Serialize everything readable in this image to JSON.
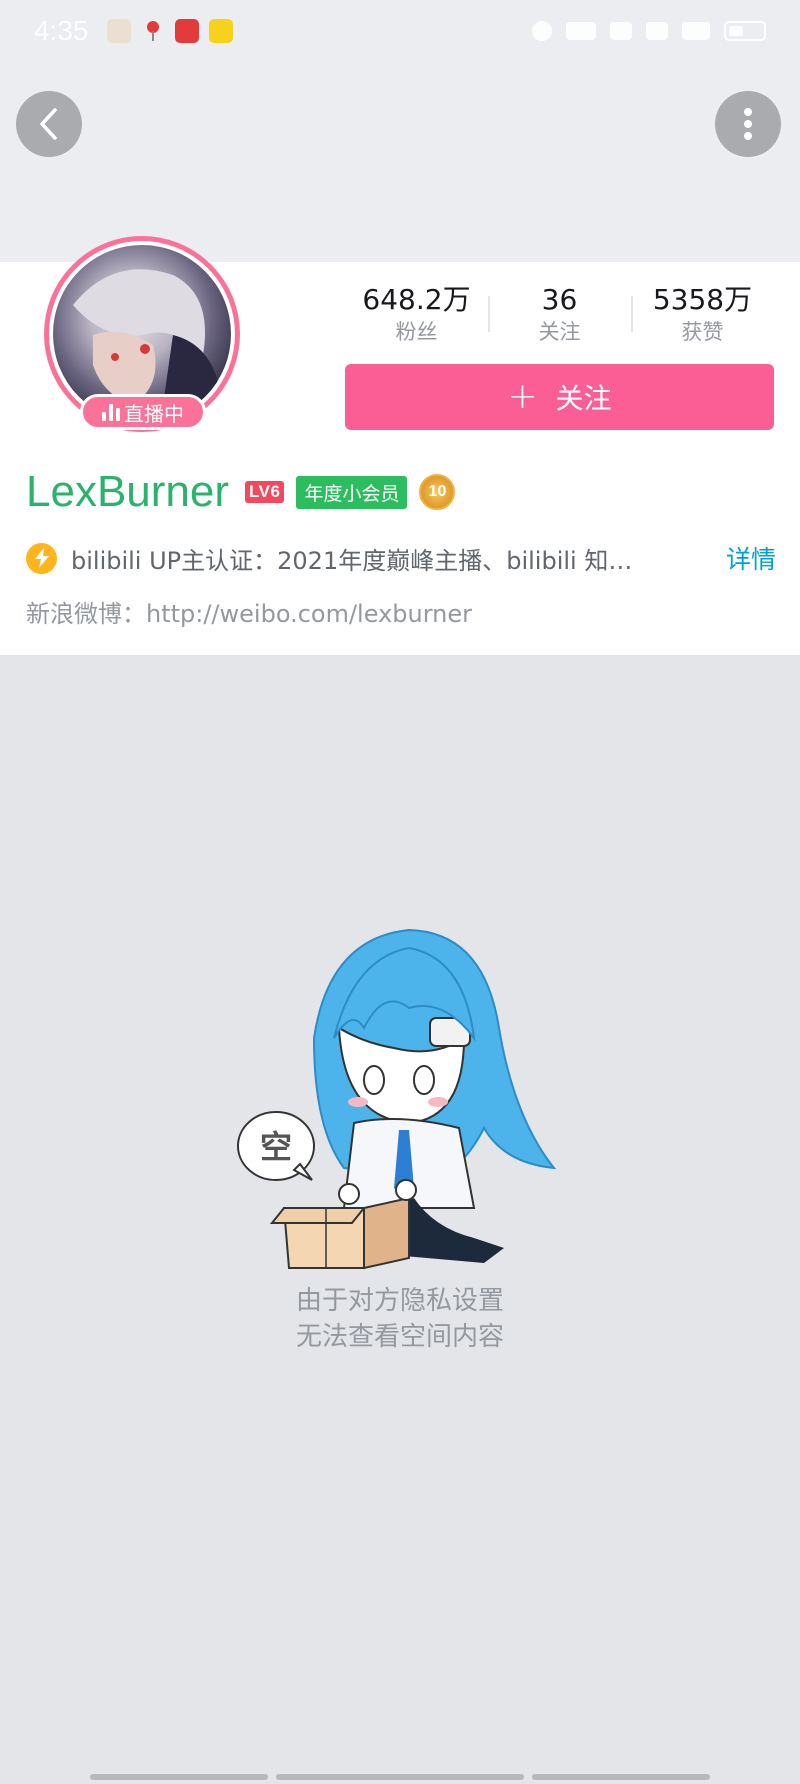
{
  "status_bar": {
    "time": "4:35",
    "notification_icons": [
      "app-notification-icon-1",
      "maps-notification-icon",
      "app-notification-icon-2",
      "app-notification-icon-3"
    ]
  },
  "header": {
    "back_icon": "chevron-left-icon",
    "more_icon": "vertical-dots-icon"
  },
  "profile": {
    "live_label": "直播中",
    "stats": [
      {
        "value": "648.2万",
        "label": "粉丝"
      },
      {
        "value": "36",
        "label": "关注"
      },
      {
        "value": "5358万",
        "label": "获赞"
      }
    ],
    "follow_button": {
      "icon": "+",
      "label": "关注"
    },
    "username": "LexBurner",
    "level": "LV6",
    "vip_badge": "年度小会员",
    "medal_level": "10",
    "certification": "bilibili UP主认证：2021年度巅峰主播、bilibili 知…",
    "details_link": "详情",
    "weibo": "新浪微博：http://weibo.com/lexburner"
  },
  "empty_state": {
    "bubble_text": "空",
    "line1": "由于对方隐私设置",
    "line2": "无法查看空间内容"
  },
  "colors": {
    "accent_pink": "#fb7299",
    "follow_button": "#fb5e94",
    "username_green": "#2cb36b",
    "link_blue": "#00a1d6",
    "vip_green": "#2cbe5e",
    "level_red": "#f2495e"
  }
}
